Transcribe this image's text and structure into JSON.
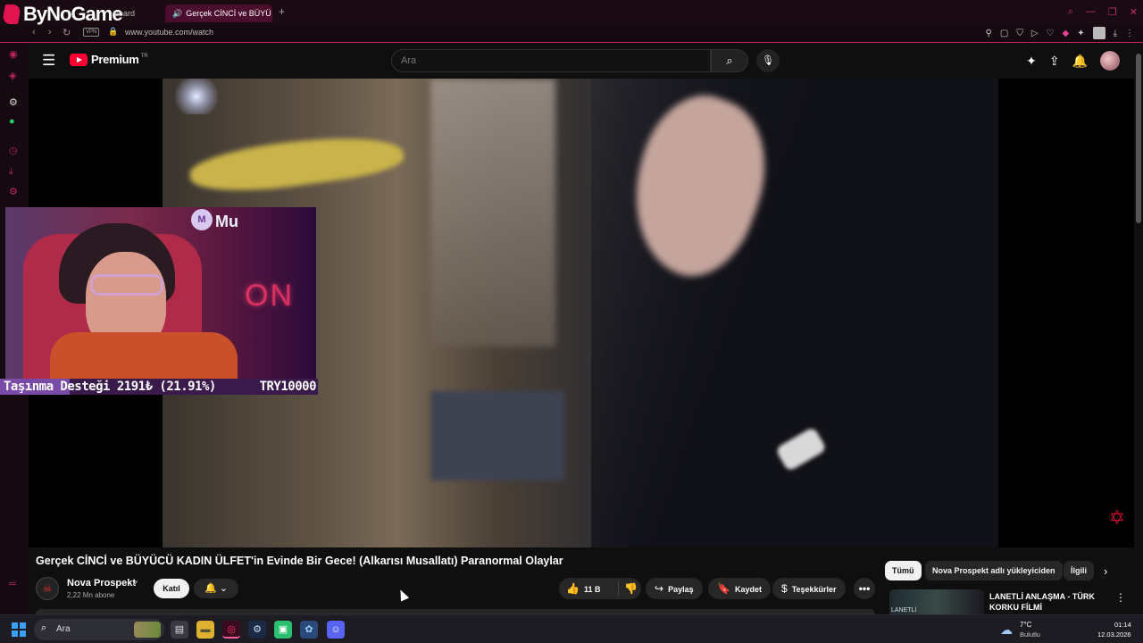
{
  "browser": {
    "brand": "ByNoGame",
    "tabs": [
      {
        "label": "board"
      },
      {
        "label": "Gerçek CİNCİ ve BÜYÜ"
      }
    ],
    "url": "www.youtube.com/watch",
    "vpn_label": "VPN",
    "accent_color": "#c2245e"
  },
  "youtube": {
    "brand": "Premium",
    "region": "TR",
    "search_placeholder": "Ara",
    "video": {
      "title": "Gerçek CİNCİ ve BÜYÜCÜ KADIN ÜLFET'in Evinde Bir Gece! (Alkarısı Musallatı) Paranormal Olaylar",
      "channel": "Nova Prospekt",
      "subscribers": "2,22 Mn abone",
      "join_label": "Katıl",
      "likes": "11 B",
      "share_label": "Paylaş",
      "save_label": "Kaydet",
      "thanks_label": "Teşekkürler"
    },
    "chips": [
      "Tümü",
      "Nova Prospekt adlı yükleyiciden",
      "İlgili"
    ],
    "related": {
      "title": "LANETLİ ANLAŞMA - TÜRK KORKU FİLMİ",
      "thumb_text": "LANETLİ"
    }
  },
  "overlay": {
    "cam_text": "Mu",
    "cam_neon": "ON",
    "donation_label": "Taşınma Desteği 2191₺ (21.91%)",
    "donation_goal": "TRY10000",
    "donation_progress": 0.2191
  },
  "taskbar": {
    "search_label": "Ara",
    "weather_temp": "7°C",
    "weather_desc": "Bulutlu",
    "time": "01:14",
    "date": "12.03.2026"
  }
}
